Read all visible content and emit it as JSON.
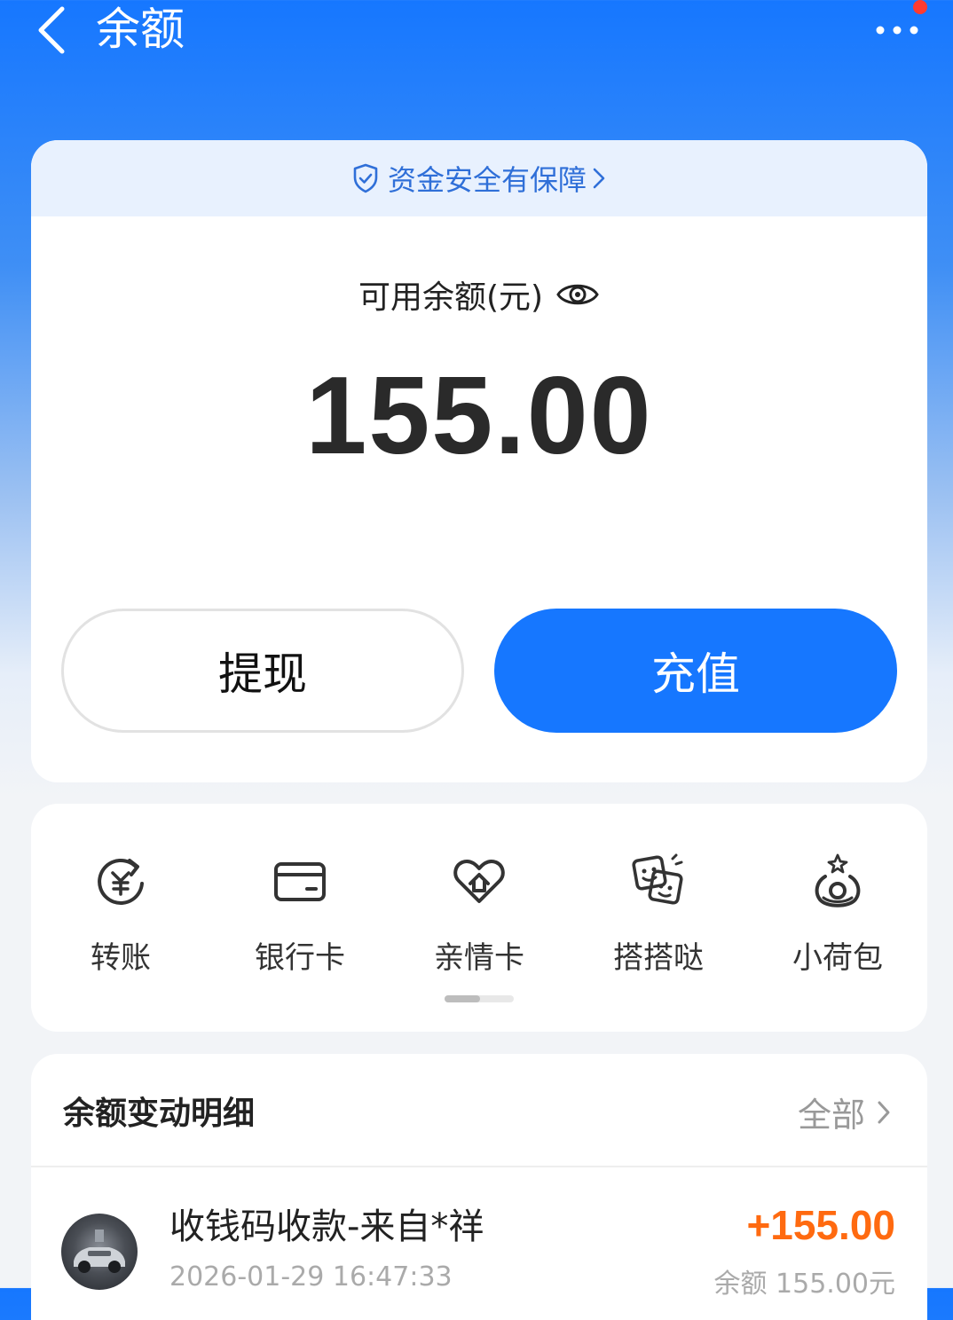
{
  "header": {
    "title": "余额"
  },
  "balance_card": {
    "safety_banner": "资金安全有保障",
    "label": "可用余额(元)",
    "amount": "155.00",
    "withdraw_label": "提现",
    "recharge_label": "充值"
  },
  "shortcuts": [
    {
      "label": "转账",
      "icon": "yuan-transfer-icon"
    },
    {
      "label": "银行卡",
      "icon": "bank-card-icon"
    },
    {
      "label": "亲情卡",
      "icon": "family-card-heart-icon"
    },
    {
      "label": "搭搭哒",
      "icon": "smiley-cards-icon"
    },
    {
      "label": "小荷包",
      "icon": "purse-icon"
    }
  ],
  "details": {
    "title": "余额变动明细",
    "all_label": "全部",
    "transactions": [
      {
        "title": "收钱码收款-来自*祥",
        "time": "2026-01-29 16:47:33",
        "amount": "+155.00",
        "balance": "余额 155.00元"
      }
    ]
  },
  "colors": {
    "primary": "#1677ff",
    "income": "#ff6a10",
    "notify_dot": "#ff3b30"
  }
}
